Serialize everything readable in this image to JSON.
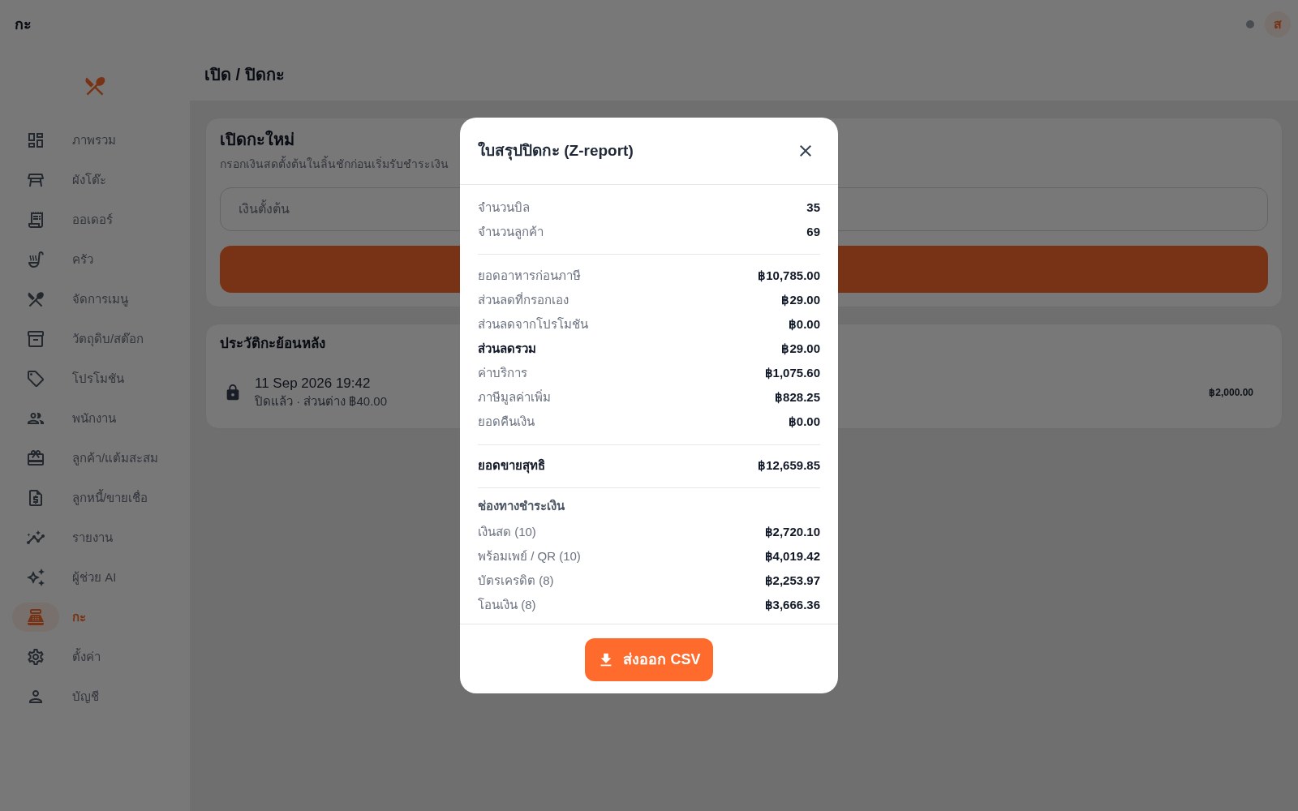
{
  "top_bar": {
    "title": "กะ",
    "avatar": "ส"
  },
  "sidebar": {
    "items": [
      {
        "label": "ภาพรวม",
        "selected": false
      },
      {
        "label": "ผังโต๊ะ",
        "selected": false
      },
      {
        "label": "ออเดอร์",
        "selected": false
      },
      {
        "label": "ครัว",
        "selected": false
      },
      {
        "label": "จัดการเมนู",
        "selected": false
      },
      {
        "label": "วัตถุดิบ/สต๊อก",
        "selected": false
      },
      {
        "label": "โปรโมชัน",
        "selected": false
      },
      {
        "label": "พนักงาน",
        "selected": false
      },
      {
        "label": "ลูกค้า/แต้มสะสม",
        "selected": false
      },
      {
        "label": "ลูกหนี้/ขายเชื่อ",
        "selected": false
      },
      {
        "label": "รายงาน",
        "selected": false
      },
      {
        "label": "ผู้ช่วย AI",
        "selected": false
      },
      {
        "label": "กะ",
        "selected": true
      },
      {
        "label": "ตั้งค่า",
        "selected": false
      },
      {
        "label": "บัญชี",
        "selected": false
      }
    ]
  },
  "page": {
    "title": "เปิด / ปิดกะ"
  },
  "open_shift_card": {
    "title": "เปิดกะใหม่",
    "subtitle": "กรอกเงินสดตั้งต้นในลิ้นชักก่อนเริ่มรับชำระเงิน",
    "amount_field": {
      "placeholder": "เงินตั้งต้น"
    }
  },
  "history_card": {
    "title": "ประวัติกะย้อนหลัง",
    "shifts": [
      {
        "date": "11 Sep 2026 19:42",
        "summary": "ปิดแล้ว · ส่วนต่าง ฿40.00",
        "amount": "฿2,000.00"
      }
    ]
  },
  "z_report_dialog": {
    "title": "ใบสรุปปิดกะ (Z-report)",
    "sections": [
      {
        "rows": [
          {
            "label": "จำนวนบิล",
            "value": "35",
            "bold": false
          },
          {
            "label": "จำนวนลูกค้า",
            "value": "69",
            "bold": false
          }
        ]
      },
      {
        "rows": [
          {
            "label": "ยอดอาหารก่อนภาษี",
            "value": "฿10,785.00",
            "bold": false
          },
          {
            "label": "ส่วนลดที่กรอกเอง",
            "value": "฿29.00",
            "bold": false
          },
          {
            "label": "ส่วนลดจากโปรโมชัน",
            "value": "฿0.00",
            "bold": false
          },
          {
            "label": "ส่วนลดรวม",
            "value": "฿29.00",
            "bold": true
          },
          {
            "label": "ค่าบริการ",
            "value": "฿1,075.60",
            "bold": false
          },
          {
            "label": "ภาษีมูลค่าเพิ่ม",
            "value": "฿828.25",
            "bold": false
          },
          {
            "label": "ยอดคืนเงิน",
            "value": "฿0.00",
            "bold": false
          }
        ]
      },
      {
        "rows": [
          {
            "label": "ยอดขายสุทธิ",
            "value": "฿12,659.85",
            "bold": true
          }
        ]
      },
      {
        "heading": "ช่องทางชำระเงิน",
        "rows": [
          {
            "label": "เงินสด (10)",
            "value": "฿2,720.10",
            "bold": false
          },
          {
            "label": "พร้อมเพย์ / QR (10)",
            "value": "฿4,019.42",
            "bold": false
          },
          {
            "label": "บัตรเครดิต (8)",
            "value": "฿2,253.97",
            "bold": false
          },
          {
            "label": "โอนเงิน (8)",
            "value": "฿3,666.36",
            "bold": false
          }
        ]
      }
    ],
    "export_button": {
      "label": "ส่งออก CSV"
    }
  }
}
